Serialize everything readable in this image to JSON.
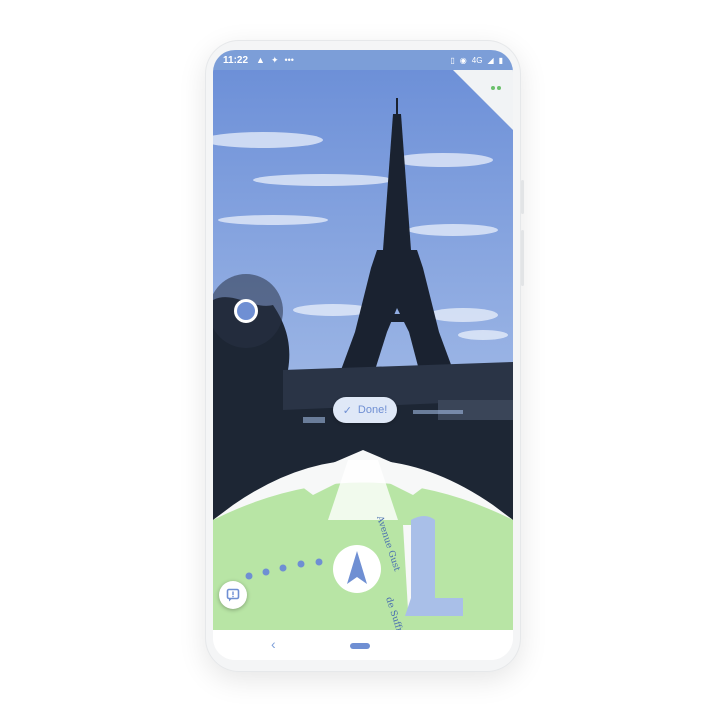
{
  "status_bar": {
    "time": "11:22",
    "network": "4G",
    "status_icons": [
      "navigation-arrow-icon",
      "signal-icon",
      "more-dots-icon"
    ],
    "right_icons": [
      "vibrate-icon",
      "location-icon",
      "cell-signal-icon",
      "battery-icon"
    ]
  },
  "ar_view": {
    "done_label": "Done!",
    "scene": "Eiffel Tower"
  },
  "map": {
    "street_labels": [
      "Avenue Gust",
      "de Suffr"
    ]
  },
  "navigation": {
    "back_icon": "back-chevron-icon",
    "home_icon": "home-pill-icon"
  },
  "colors": {
    "accent": "#6f8fd3",
    "status_bar": "#7c9ed8",
    "park_green": "#b8e5a5",
    "road_white": "#f7f8f8",
    "route_blue": "#a9bfe8"
  }
}
